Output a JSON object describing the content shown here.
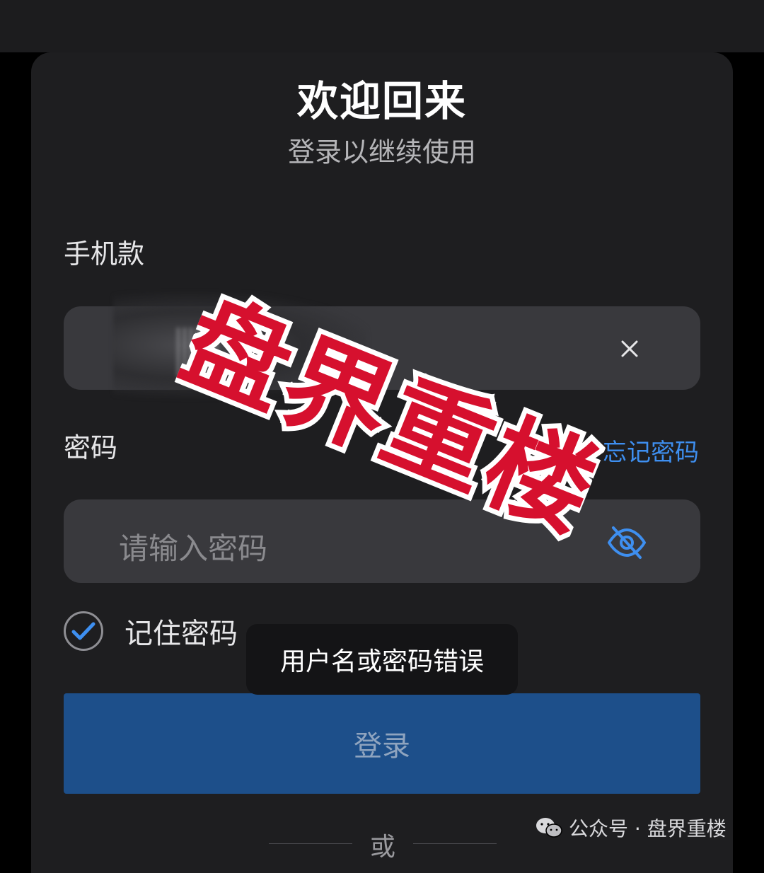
{
  "header": {
    "title": "欢迎回来",
    "subtitle": "登录以继续使用"
  },
  "phone": {
    "label": "手机款",
    "clear_icon": "close-icon"
  },
  "password": {
    "label": "密码",
    "forgot_link": "忘记密码",
    "placeholder": "请输入密码",
    "visibility_icon": "eye-off-icon"
  },
  "remember": {
    "label": "记住密码",
    "checked": true
  },
  "toast": {
    "message": "用户名或密码错误"
  },
  "login_button": {
    "label": "登录"
  },
  "divider": {
    "text": "或"
  },
  "stamp": {
    "text": "盘界重楼"
  },
  "watermark": {
    "text": "公众号 · 盘界重楼",
    "icon": "wechat-icon"
  },
  "colors": {
    "background": "#1e1e20",
    "field": "#39393d",
    "accent": "#3e8ff0",
    "button": "#1d4f8a",
    "stamp_red": "#d6102e"
  }
}
